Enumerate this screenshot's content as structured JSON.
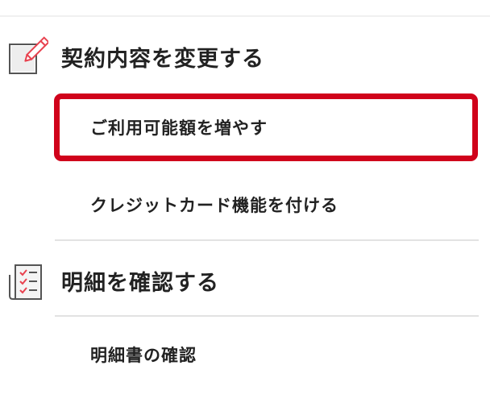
{
  "sections": [
    {
      "title": "契約内容を変更する",
      "icon": "pencil-edit-icon",
      "items": [
        {
          "label": "ご利用可能額を増やす",
          "highlighted": true
        },
        {
          "label": "クレジットカード機能を付ける",
          "highlighted": false
        }
      ]
    },
    {
      "title": "明細を確認する",
      "icon": "checklist-document-icon",
      "items": [
        {
          "label": "明細書の確認",
          "highlighted": false
        }
      ]
    }
  ],
  "colors": {
    "highlight_border": "#d0021b",
    "icon_accent": "#e8424f",
    "text": "#222222",
    "divider": "#e2e2e2"
  }
}
